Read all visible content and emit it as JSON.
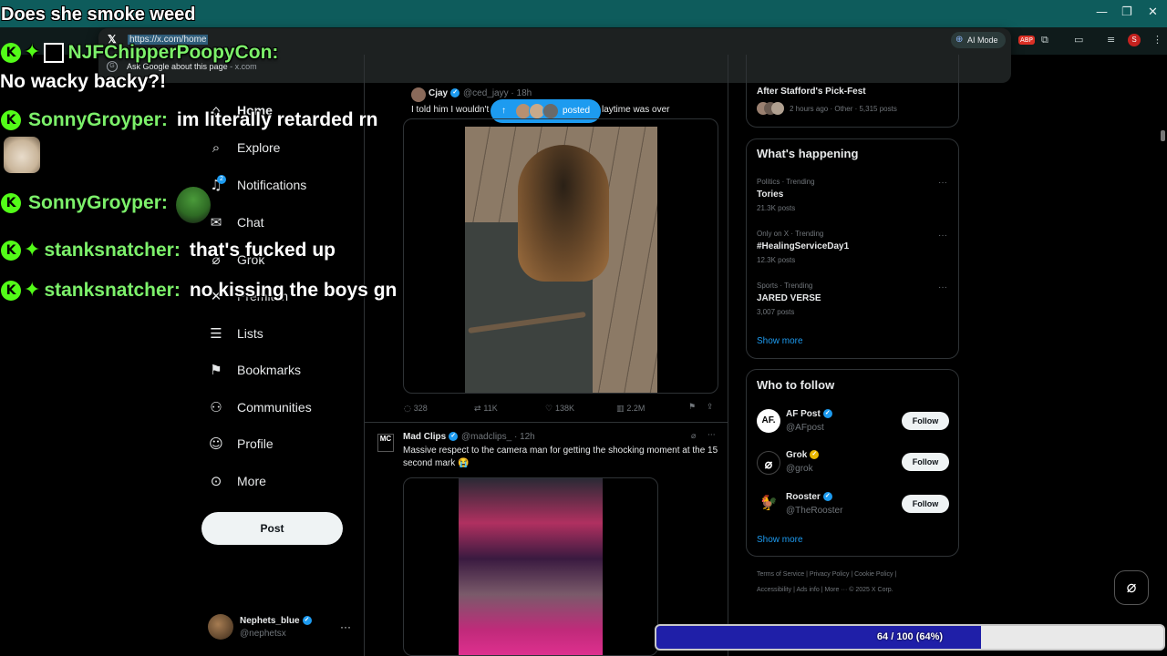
{
  "browser": {
    "window_controls": {
      "minimize": "—",
      "maximize": "❐",
      "close": "✕"
    },
    "omnibox": {
      "url": "https://x.com/home",
      "suggestion": "Ask Google about this page",
      "suggestion_domain": "x.com",
      "ai_mode": "AI Mode"
    },
    "extensions": [
      "ABP",
      "puzzle-icon",
      "sidebar-icon",
      "media-icon",
      "S",
      "kebab-icon"
    ]
  },
  "x_nav": {
    "items": [
      {
        "label": "Home",
        "icon": "home-icon"
      },
      {
        "label": "Explore",
        "icon": "search-icon"
      },
      {
        "label": "Notifications",
        "icon": "bell-icon",
        "badge": "2"
      },
      {
        "label": "Chat",
        "icon": "mail-icon"
      },
      {
        "label": "Grok",
        "icon": "grok-icon"
      },
      {
        "label": "Premium",
        "icon": "x-icon"
      },
      {
        "label": "Lists",
        "icon": "list-icon"
      },
      {
        "label": "Bookmarks",
        "icon": "bookmark-icon"
      },
      {
        "label": "Communities",
        "icon": "people-icon"
      },
      {
        "label": "Profile",
        "icon": "person-icon"
      },
      {
        "label": "More",
        "icon": "more-circle-icon"
      }
    ],
    "post_button": "Post",
    "account": {
      "name": "Nephets_blue",
      "handle": "@nephetsx"
    }
  },
  "timeline": {
    "posted_pill": "posted",
    "tweets": [
      {
        "name": "Cjay",
        "handle": "@ced_jayy",
        "time": "18h",
        "text_start": "I told him I wouldn't",
        "text_end": "laytime was over",
        "replies": "328",
        "reposts": "11K",
        "likes": "138K",
        "views": "2.2M"
      },
      {
        "name": "Mad Clips",
        "handle": "@madclips_",
        "time": "12h",
        "logo": "MC",
        "text": "Massive respect to the camera man for getting the shocking moment at the 15 second mark 😭"
      }
    ]
  },
  "sidebar": {
    "top_item": {
      "title": "After Stafford's Pick-Fest",
      "meta": "2 hours ago · Other · 5,315 posts"
    },
    "whats_happening": {
      "title": "What's happening",
      "trends": [
        {
          "meta": "Politics · Trending",
          "name": "Tories",
          "posts": "21.3K posts"
        },
        {
          "meta": "Only on X · Trending",
          "name": "#HealingServiceDay1",
          "posts": "12.3K posts"
        },
        {
          "meta": "Sports · Trending",
          "name": "JARED VERSE",
          "posts": "3,007 posts"
        }
      ],
      "show_more": "Show more"
    },
    "who_to_follow": {
      "title": "Who to follow",
      "accounts": [
        {
          "name": "AF Post",
          "handle": "@AFpost",
          "avatar": "AF.",
          "follow": "Follow"
        },
        {
          "name": "Grok",
          "handle": "@grok",
          "avatar": "⌀",
          "follow": "Follow"
        },
        {
          "name": "Rooster",
          "handle": "@TheRooster",
          "avatar": "🐓",
          "follow": "Follow"
        }
      ],
      "show_more": "Show more"
    },
    "footer": {
      "line1": "Terms of Service  |  Privacy Policy  |  Cookie Policy  |",
      "line2": "Accessibility  |  Ads info  |  More ···  © 2025 X Corp."
    }
  },
  "chat_overlay": {
    "title": "Does she smoke weed",
    "messages": [
      {
        "user": "NJFChipperPoopyCon:",
        "text": "No wacky backy?!"
      },
      {
        "user": "SonnyGroyper:",
        "text": "im literally retarded rn"
      },
      {
        "user": "SonnyGroyper:",
        "text": ""
      },
      {
        "user": "stanksnatcher:",
        "text": "that's fucked up"
      },
      {
        "user": "stanksnatcher:",
        "text": "no kissing the boys gn"
      }
    ]
  },
  "progress": {
    "label": "64 / 100 (64%)",
    "fraction": 0.64
  },
  "colors": {
    "accent": "#1d9bf0",
    "chat_user": "#7cf06a",
    "kick_green": "#53fc18",
    "progress_fill": "#1f1fa8"
  }
}
